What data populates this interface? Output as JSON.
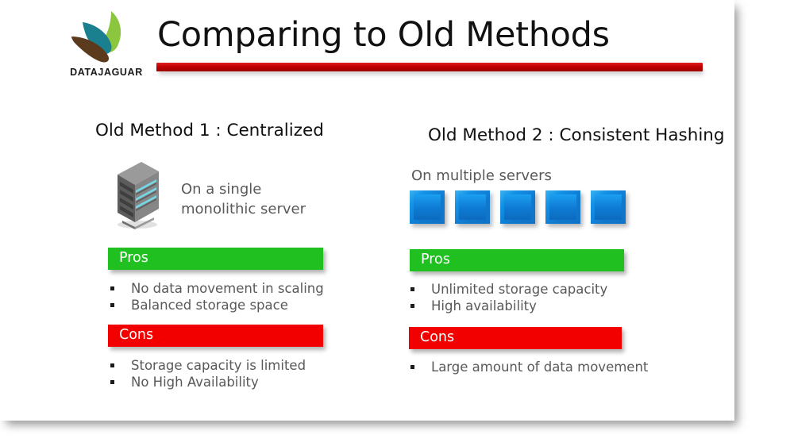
{
  "brand": {
    "logo_name": "datajaguar-logo",
    "logo_text": "DATAJAGUAR",
    "leaf_green": "#8cc63f",
    "leaf_teal": "#1a7f8e",
    "leaf_brown": "#5b3a1e"
  },
  "header": {
    "title": "Comparing to Old Methods",
    "rule_color": "#c00000"
  },
  "columns": [
    {
      "heading": "Old Method 1 :   Centralized",
      "caption": "On a single\nmonolithic server",
      "caption_line1": "On a single",
      "caption_line2": "monolithic server",
      "visual": "single-server-icon",
      "pros": {
        "label": "Pros",
        "color": "#20c020",
        "items": [
          "No data movement in scaling",
          "Balanced storage space"
        ]
      },
      "cons": {
        "label": "Cons",
        "color": "#f20000",
        "items": [
          "Storage capacity is limited",
          "No High Availability"
        ]
      }
    },
    {
      "heading": "Old Method 2 :  Consistent Hashing",
      "caption": "On multiple servers",
      "visual": "five-server-squares",
      "server_count": 5,
      "square_color": "#1391e6",
      "pros": {
        "label": "Pros",
        "color": "#20c020",
        "items": [
          "Unlimited storage capacity",
          "High availability"
        ]
      },
      "cons": {
        "label": "Cons",
        "color": "#f20000",
        "items": [
          "Large amount of data movement"
        ]
      }
    }
  ]
}
